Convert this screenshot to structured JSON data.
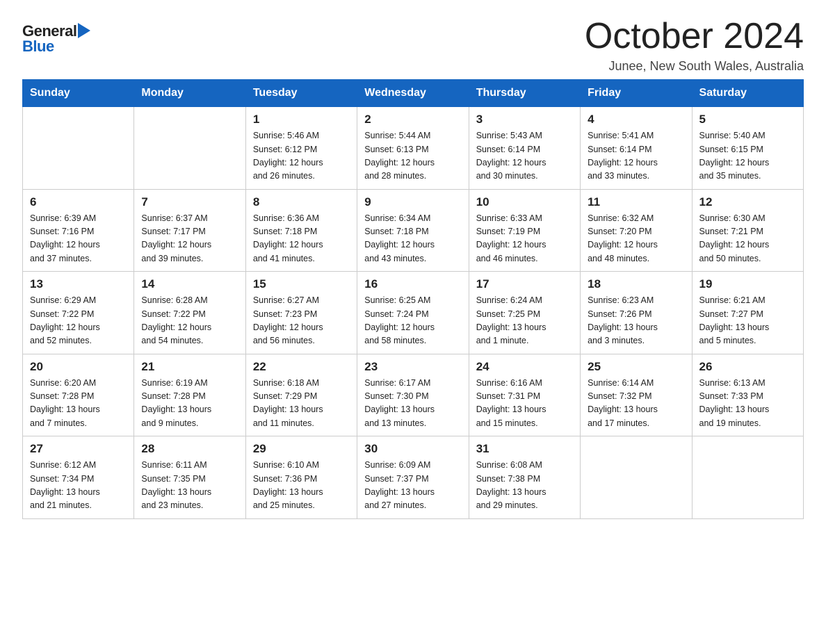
{
  "logo": {
    "general": "General",
    "blue": "Blue"
  },
  "title": "October 2024",
  "subtitle": "Junee, New South Wales, Australia",
  "days_of_week": [
    "Sunday",
    "Monday",
    "Tuesday",
    "Wednesday",
    "Thursday",
    "Friday",
    "Saturday"
  ],
  "weeks": [
    [
      {
        "day": "",
        "info": ""
      },
      {
        "day": "",
        "info": ""
      },
      {
        "day": "1",
        "info": "Sunrise: 5:46 AM\nSunset: 6:12 PM\nDaylight: 12 hours\nand 26 minutes."
      },
      {
        "day": "2",
        "info": "Sunrise: 5:44 AM\nSunset: 6:13 PM\nDaylight: 12 hours\nand 28 minutes."
      },
      {
        "day": "3",
        "info": "Sunrise: 5:43 AM\nSunset: 6:14 PM\nDaylight: 12 hours\nand 30 minutes."
      },
      {
        "day": "4",
        "info": "Sunrise: 5:41 AM\nSunset: 6:14 PM\nDaylight: 12 hours\nand 33 minutes."
      },
      {
        "day": "5",
        "info": "Sunrise: 5:40 AM\nSunset: 6:15 PM\nDaylight: 12 hours\nand 35 minutes."
      }
    ],
    [
      {
        "day": "6",
        "info": "Sunrise: 6:39 AM\nSunset: 7:16 PM\nDaylight: 12 hours\nand 37 minutes."
      },
      {
        "day": "7",
        "info": "Sunrise: 6:37 AM\nSunset: 7:17 PM\nDaylight: 12 hours\nand 39 minutes."
      },
      {
        "day": "8",
        "info": "Sunrise: 6:36 AM\nSunset: 7:18 PM\nDaylight: 12 hours\nand 41 minutes."
      },
      {
        "day": "9",
        "info": "Sunrise: 6:34 AM\nSunset: 7:18 PM\nDaylight: 12 hours\nand 43 minutes."
      },
      {
        "day": "10",
        "info": "Sunrise: 6:33 AM\nSunset: 7:19 PM\nDaylight: 12 hours\nand 46 minutes."
      },
      {
        "day": "11",
        "info": "Sunrise: 6:32 AM\nSunset: 7:20 PM\nDaylight: 12 hours\nand 48 minutes."
      },
      {
        "day": "12",
        "info": "Sunrise: 6:30 AM\nSunset: 7:21 PM\nDaylight: 12 hours\nand 50 minutes."
      }
    ],
    [
      {
        "day": "13",
        "info": "Sunrise: 6:29 AM\nSunset: 7:22 PM\nDaylight: 12 hours\nand 52 minutes."
      },
      {
        "day": "14",
        "info": "Sunrise: 6:28 AM\nSunset: 7:22 PM\nDaylight: 12 hours\nand 54 minutes."
      },
      {
        "day": "15",
        "info": "Sunrise: 6:27 AM\nSunset: 7:23 PM\nDaylight: 12 hours\nand 56 minutes."
      },
      {
        "day": "16",
        "info": "Sunrise: 6:25 AM\nSunset: 7:24 PM\nDaylight: 12 hours\nand 58 minutes."
      },
      {
        "day": "17",
        "info": "Sunrise: 6:24 AM\nSunset: 7:25 PM\nDaylight: 13 hours\nand 1 minute."
      },
      {
        "day": "18",
        "info": "Sunrise: 6:23 AM\nSunset: 7:26 PM\nDaylight: 13 hours\nand 3 minutes."
      },
      {
        "day": "19",
        "info": "Sunrise: 6:21 AM\nSunset: 7:27 PM\nDaylight: 13 hours\nand 5 minutes."
      }
    ],
    [
      {
        "day": "20",
        "info": "Sunrise: 6:20 AM\nSunset: 7:28 PM\nDaylight: 13 hours\nand 7 minutes."
      },
      {
        "day": "21",
        "info": "Sunrise: 6:19 AM\nSunset: 7:28 PM\nDaylight: 13 hours\nand 9 minutes."
      },
      {
        "day": "22",
        "info": "Sunrise: 6:18 AM\nSunset: 7:29 PM\nDaylight: 13 hours\nand 11 minutes."
      },
      {
        "day": "23",
        "info": "Sunrise: 6:17 AM\nSunset: 7:30 PM\nDaylight: 13 hours\nand 13 minutes."
      },
      {
        "day": "24",
        "info": "Sunrise: 6:16 AM\nSunset: 7:31 PM\nDaylight: 13 hours\nand 15 minutes."
      },
      {
        "day": "25",
        "info": "Sunrise: 6:14 AM\nSunset: 7:32 PM\nDaylight: 13 hours\nand 17 minutes."
      },
      {
        "day": "26",
        "info": "Sunrise: 6:13 AM\nSunset: 7:33 PM\nDaylight: 13 hours\nand 19 minutes."
      }
    ],
    [
      {
        "day": "27",
        "info": "Sunrise: 6:12 AM\nSunset: 7:34 PM\nDaylight: 13 hours\nand 21 minutes."
      },
      {
        "day": "28",
        "info": "Sunrise: 6:11 AM\nSunset: 7:35 PM\nDaylight: 13 hours\nand 23 minutes."
      },
      {
        "day": "29",
        "info": "Sunrise: 6:10 AM\nSunset: 7:36 PM\nDaylight: 13 hours\nand 25 minutes."
      },
      {
        "day": "30",
        "info": "Sunrise: 6:09 AM\nSunset: 7:37 PM\nDaylight: 13 hours\nand 27 minutes."
      },
      {
        "day": "31",
        "info": "Sunrise: 6:08 AM\nSunset: 7:38 PM\nDaylight: 13 hours\nand 29 minutes."
      },
      {
        "day": "",
        "info": ""
      },
      {
        "day": "",
        "info": ""
      }
    ]
  ]
}
